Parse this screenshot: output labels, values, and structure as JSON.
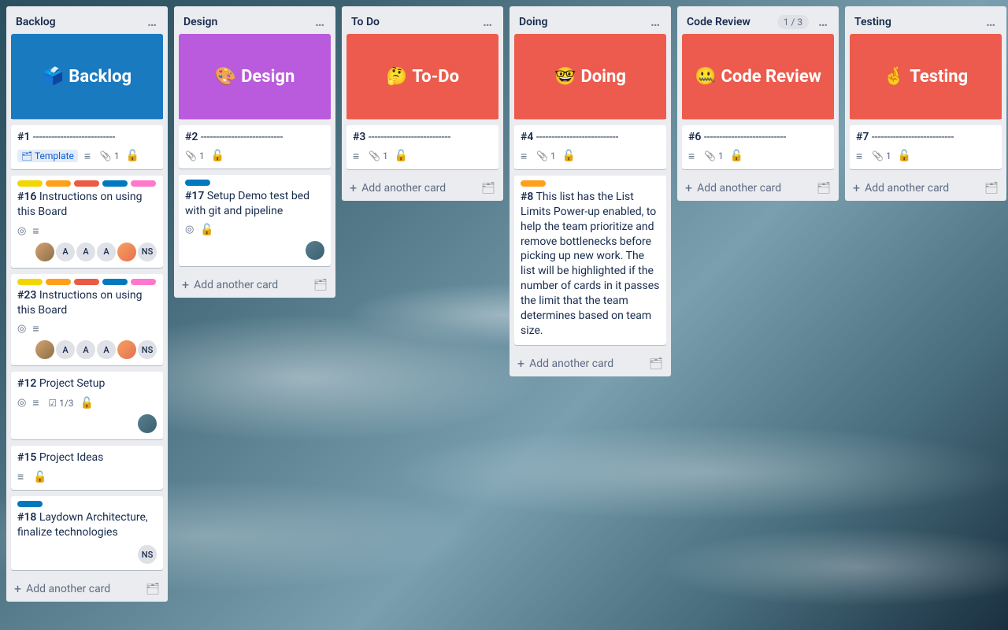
{
  "add_card_label": "Add another card",
  "template_label": "Template",
  "colors": {
    "yellow": "#f2d600",
    "orange": "#ff9f1a",
    "red": "#eb5a46",
    "blue": "#0079bf",
    "pink": "#ff78cb",
    "hero_red": "#ec5b4d",
    "hero_blue": "#1a7abf",
    "hero_purple": "#b95bdc"
  },
  "lists": [
    {
      "title": "Backlog",
      "hero": {
        "emoji": "🗳️",
        "text": "Backlog",
        "bg": "hero_blue"
      },
      "cards": [
        {
          "num": "#1",
          "text": "---------------------------",
          "template": true,
          "desc": true,
          "attach": 1,
          "unlock": true
        },
        {
          "num": "#16",
          "text": "Instructions on using this Board",
          "labels": [
            "yellow",
            "orange",
            "red",
            "blue",
            "pink"
          ],
          "watch": true,
          "desc": true,
          "members": [
            "photo1",
            "A",
            "A",
            "A",
            "photo2",
            "NS"
          ]
        },
        {
          "num": "#23",
          "text": "Instructions on using this Board",
          "labels": [
            "yellow",
            "orange",
            "red",
            "blue",
            "pink"
          ],
          "watch": true,
          "desc": true,
          "members": [
            "photo1",
            "A",
            "A",
            "A",
            "photo2",
            "NS"
          ]
        },
        {
          "num": "#12",
          "text": "Project Setup",
          "watch": true,
          "desc": true,
          "checklist": "1/3",
          "unlock": true,
          "members": [
            "photo3"
          ]
        },
        {
          "num": "#15",
          "text": "Project Ideas",
          "desc": true,
          "unlock": true
        },
        {
          "num": "#18",
          "text": "Laydown Architecture, finalize technologies",
          "labels": [
            "blue"
          ],
          "members": [
            "NS"
          ]
        }
      ]
    },
    {
      "title": "Design",
      "hero": {
        "emoji": "🎨",
        "text": "Design",
        "bg": "hero_purple"
      },
      "cards": [
        {
          "num": "#2",
          "text": "---------------------------",
          "attach": 1,
          "unlock": true
        },
        {
          "num": "#17",
          "text": "Setup Demo test bed with git and pipeline",
          "labels": [
            "blue"
          ],
          "watch": true,
          "unlock": true,
          "members": [
            "photo3"
          ]
        }
      ]
    },
    {
      "title": "To Do",
      "hero": {
        "emoji": "🤔",
        "text": "To-Do",
        "bg": "hero_red"
      },
      "cards": [
        {
          "num": "#3",
          "text": "---------------------------",
          "desc": true,
          "attach": 1,
          "unlock": true
        }
      ]
    },
    {
      "title": "Doing",
      "hero": {
        "emoji": "🤓",
        "text": "Doing",
        "bg": "hero_red"
      },
      "cards": [
        {
          "num": "#4",
          "text": "---------------------------",
          "desc": true,
          "attach": 1,
          "unlock": true
        },
        {
          "num": "#8",
          "text": "This list has the List Limits Power-up enabled, to help the team prioritize and remove bottlenecks before picking up new work. The list will be highlighted if the number of cards in it passes the limit that the team determines based on team size.",
          "labels": [
            "orange"
          ]
        }
      ]
    },
    {
      "title": "Code Review",
      "badge": "1 / 3",
      "hero": {
        "emoji": "🤐",
        "text": "Code Review",
        "bg": "hero_red"
      },
      "cards": [
        {
          "num": "#6",
          "text": "---------------------------",
          "desc": true,
          "attach": 1,
          "unlock": true
        }
      ]
    },
    {
      "title": "Testing",
      "hero": {
        "emoji": "🤞",
        "text": "Testing",
        "bg": "hero_red"
      },
      "cards": [
        {
          "num": "#7",
          "text": "---------------------------",
          "desc": true,
          "attach": 1,
          "unlock": true
        }
      ]
    }
  ]
}
